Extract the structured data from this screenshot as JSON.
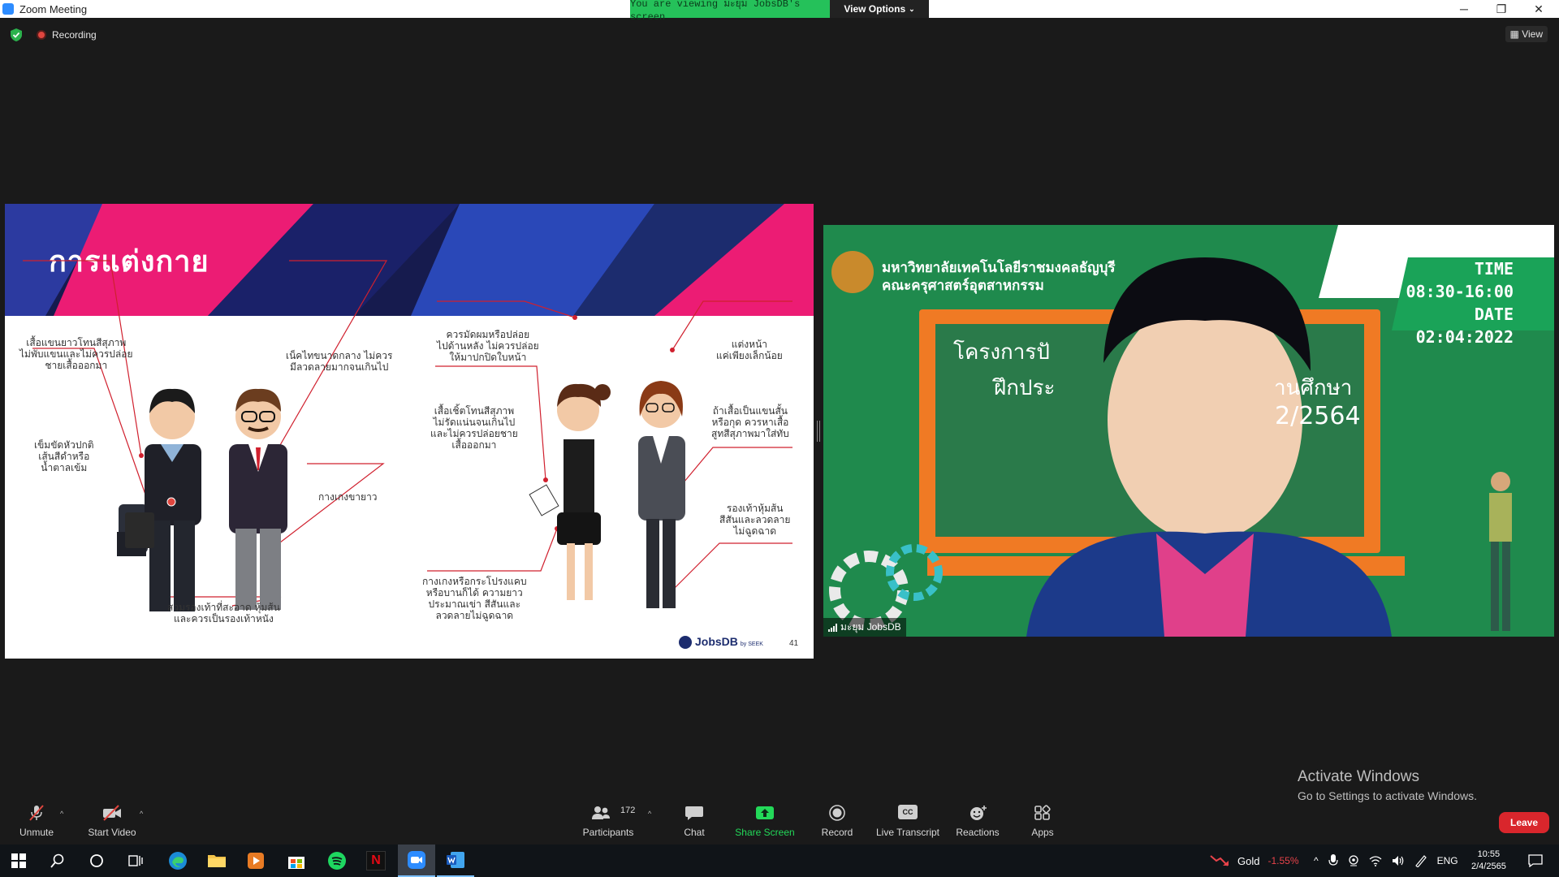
{
  "window": {
    "title": "Zoom Meeting",
    "viewing_banner": "You are viewing มะยุม JobsDB's screen",
    "view_options": "View Options",
    "minimize": "─",
    "maximize": "❐",
    "close": "✕"
  },
  "status": {
    "recording": "Recording",
    "view": "View"
  },
  "slide": {
    "title": "การแต่งกาย",
    "callouts": {
      "shirt_long": [
        "เสื้อแขนยาวโทนสีสุภาพ",
        "ไม่พับแขนและไม่ควรปล่อย",
        "ชายเสื้อออกมา"
      ],
      "tie": [
        "เน็คไทขนาดกลาง ไม่ควร",
        "มีลวดลายมากจนเกินไป"
      ],
      "belt": [
        "เข็มขัดหัวปกติ",
        "เส้นสีดำหรือ",
        "น้ำตาลเข้ม"
      ],
      "pants": [
        "กางเกงขายาว"
      ],
      "shoes_men": [
        "สวมรองเท้าที่สะอาด หุ้มส้น",
        "และควรเป็นรองเท้าหนัง"
      ],
      "hair": [
        "ควรมัดผมหรือปล่อย",
        "ไปด้านหลัง ไม่ควรปล่อย",
        "ให้มาปกปิดใบหน้า"
      ],
      "shirt_women": [
        "เสื้อเชิ้ตโทนสีสุภาพ",
        "ไม่รัดแน่นจนเกินไป",
        "และไม่ควรปล่อยชาย",
        "เสื้อออกมา"
      ],
      "skirt": [
        "กางเกงหรือกระโปรงแคบ",
        "หรือบานก็ได้ ความยาว",
        "ประมาณเข่า สีสันและ",
        "ลวดลายไม่ฉูดฉาด"
      ],
      "makeup": [
        "แต่งหน้า",
        "แค่เพียงเล็กน้อย"
      ],
      "short_sleeve": [
        "ถ้าเสื้อเป็นแขนสั้น",
        "หรือกุด ควรหาเสื้อ",
        "สูทสีสุภาพมาใส่ทับ"
      ],
      "shoes_women": [
        "รองเท้าหุ้มส้น",
        "สีสันและลวดลาย",
        "ไม่ฉูดฉาด"
      ]
    },
    "logo": "JobsDB",
    "logo_by": "by SEEK",
    "page_number": "41"
  },
  "video": {
    "university": [
      "มหาวิทยาลัยเทคโนโลยีราชมงคลธัญบุรี",
      "คณะครุศาสตร์อุตสาหกรรม"
    ],
    "time_label": "TIME",
    "time_value": "08:30-16:00",
    "date_label": "DATE",
    "date_value": "02:04:2022",
    "board_line1": "โครงการปั",
    "board_line2": "ฝึกประ",
    "board_line3": "านศึกษา",
    "board_line4": "2/2564",
    "participant_name": "มะยุม JobsDB"
  },
  "activate": {
    "line1": "Activate Windows",
    "line2": "Go to Settings to activate Windows."
  },
  "toolbar": {
    "unmute": "Unmute",
    "start_video": "Start Video",
    "participants": "Participants",
    "participants_count": "172",
    "chat": "Chat",
    "share_screen": "Share Screen",
    "record": "Record",
    "live_transcript": "Live Transcript",
    "reactions": "Reactions",
    "apps": "Apps",
    "leave": "Leave",
    "cc": "CC"
  },
  "taskbar": {
    "stock_name": "Gold",
    "stock_change": "-1.55%",
    "language": "ENG",
    "time": "10:55",
    "date": "2/4/2565"
  },
  "colors": {
    "share_green": "#23d959",
    "leave_red": "#d9262c",
    "slide_navy": "#1c2c6e",
    "slide_pink": "#ec1c74",
    "board_green": "#1f8a4d",
    "board_orange": "#f07a24",
    "stock_red": "#e8434a"
  }
}
